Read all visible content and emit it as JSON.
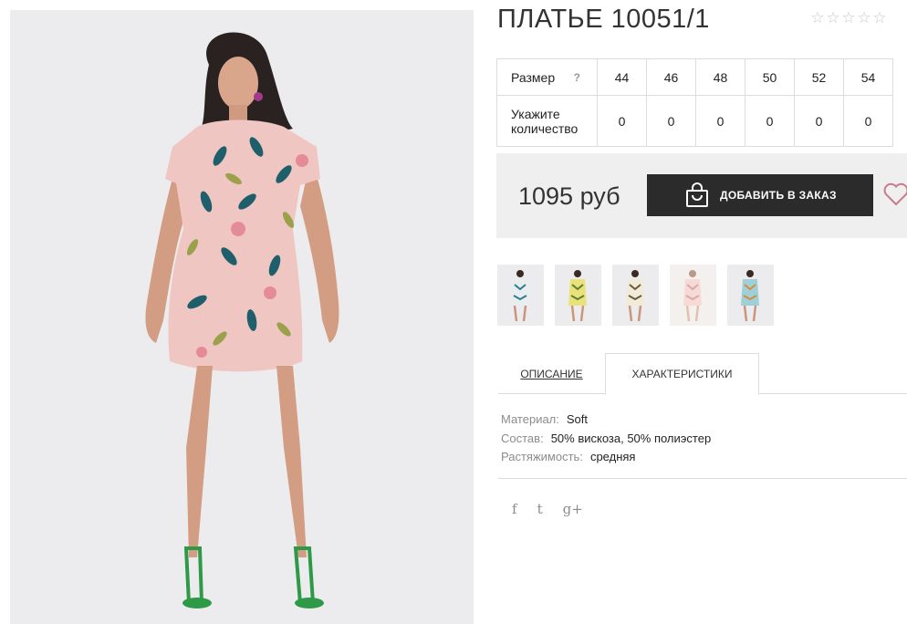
{
  "product": {
    "title": "ПЛАТЬЕ 10051/1",
    "rating": {
      "stars_filled": 0,
      "stars_total": 5
    }
  },
  "sizes": {
    "size_label": "Размер",
    "help": "?",
    "qty_label": "Укажите количество",
    "list": [
      "44",
      "46",
      "48",
      "50",
      "52",
      "54"
    ],
    "quantities": [
      "0",
      "0",
      "0",
      "0",
      "0",
      "0"
    ]
  },
  "purchase": {
    "price": "1095 руб",
    "add_label": "ДОБАВИТЬ В ЗАКАЗ"
  },
  "tabs": {
    "description": "ОПИСАНИЕ",
    "characteristics": "ХАРАКТЕРИСТИКИ",
    "active": "characteristics"
  },
  "specs": [
    {
      "key": "Материал:",
      "value": "Soft"
    },
    {
      "key": "Состав:",
      "value": "50% вискоза, 50% полиэстер"
    },
    {
      "key": "Растяжимость:",
      "value": "средняя"
    }
  ],
  "social": {
    "facebook": "f",
    "twitter": "t",
    "googleplus": "g+"
  },
  "colors": {
    "button_bg": "#2b2b2b",
    "panel_bg": "#efefef",
    "dress_pink": "#f0c6c2",
    "shoe_green": "#2e9a48",
    "muted_text": "#8c8c8c"
  },
  "thumbnails": [
    {
      "name": "thumb-white-blue"
    },
    {
      "name": "thumb-yellow-green"
    },
    {
      "name": "thumb-cream-brown"
    },
    {
      "name": "thumb-pink-floral"
    },
    {
      "name": "thumb-blue-teal"
    }
  ],
  "icons": {
    "star": "star-outline-icon",
    "bag": "shopping-bag-icon",
    "heart": "heart-outline-icon"
  }
}
